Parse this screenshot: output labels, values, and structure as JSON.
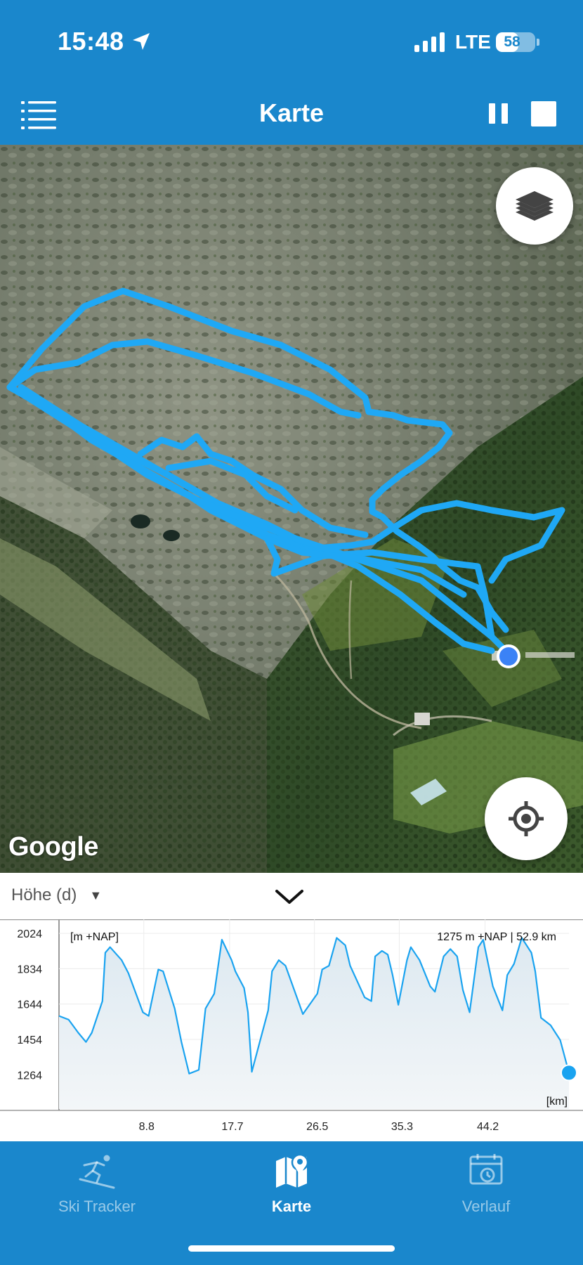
{
  "status_bar": {
    "time": "15:48",
    "network": "LTE",
    "battery_level": "58",
    "location_icon": "location-arrow-icon",
    "signal_icon": "cellular-signal-icon"
  },
  "header": {
    "title": "Karte",
    "menu_icon": "list-menu-icon",
    "pause_icon": "pause-icon",
    "stop_icon": "stop-icon"
  },
  "map": {
    "attribution": "Google",
    "layers_icon": "layers-icon",
    "locate_icon": "crosshair-locate-icon",
    "track_color": "#1fa8f5",
    "position_color": "#3b82f6"
  },
  "chart_panel": {
    "metric_label": "Höhe (d)",
    "dropdown_arrow": "▼",
    "collapse_icon": "chevron-down-icon"
  },
  "chart_data": {
    "type": "area",
    "ylabel": "[m +NAP]",
    "xlabel": "[km]",
    "readout": "1275 m +NAP | 52.9  km",
    "y_ticks": [
      "2024",
      "1834",
      "1644",
      "1454",
      "1264"
    ],
    "x_ticks": [
      "8.8",
      "17.7",
      "26.5",
      "35.3",
      "44.2"
    ],
    "xlim": [
      0,
      52.9
    ],
    "ylim": [
      1080,
      2100
    ],
    "line_color": "#1aa3f0",
    "fill_color": "#dde9f1",
    "x": [
      0,
      1.0,
      2.0,
      2.8,
      3.4,
      4.5,
      4.8,
      5.3,
      6.5,
      7.2,
      8.7,
      9.3,
      10.3,
      10.8,
      12.0,
      12.7,
      13.5,
      14.5,
      15.2,
      16.1,
      16.9,
      17.9,
      18.3,
      19.2,
      19.6,
      20.0,
      21.7,
      22.1,
      22.8,
      23.5,
      25.3,
      26.8,
      27.3,
      28.0,
      28.8,
      29.7,
      30.2,
      31.7,
      32.4,
      32.8,
      33.5,
      34.1,
      34.6,
      35.2,
      36.1,
      36.5,
      37.4,
      38.5,
      39.0,
      39.9,
      40.6,
      41.3,
      41.9,
      42.6,
      43.5,
      44.0,
      45.0,
      46.0,
      46.5,
      47.2,
      48.0,
      49.0,
      49.4,
      50.0,
      51.0,
      52.0,
      52.9
    ],
    "y": [
      1580,
      1560,
      1490,
      1440,
      1490,
      1660,
      1920,
      1950,
      1880,
      1810,
      1600,
      1580,
      1830,
      1820,
      1620,
      1440,
      1270,
      1290,
      1620,
      1700,
      1990,
      1880,
      1820,
      1730,
      1600,
      1280,
      1610,
      1820,
      1880,
      1850,
      1590,
      1700,
      1830,
      1850,
      2000,
      1960,
      1850,
      1680,
      1660,
      1900,
      1930,
      1910,
      1800,
      1640,
      1880,
      1950,
      1880,
      1740,
      1710,
      1900,
      1940,
      1900,
      1720,
      1600,
      1950,
      1990,
      1740,
      1610,
      1800,
      1860,
      2000,
      1920,
      1820,
      1570,
      1530,
      1450,
      1275
    ]
  },
  "tabs": [
    {
      "label": "Ski Tracker",
      "icon": "skier-icon",
      "active": false
    },
    {
      "label": "Karte",
      "icon": "map-pin-icon",
      "active": true
    },
    {
      "label": "Verlauf",
      "icon": "calendar-history-icon",
      "active": false
    }
  ]
}
